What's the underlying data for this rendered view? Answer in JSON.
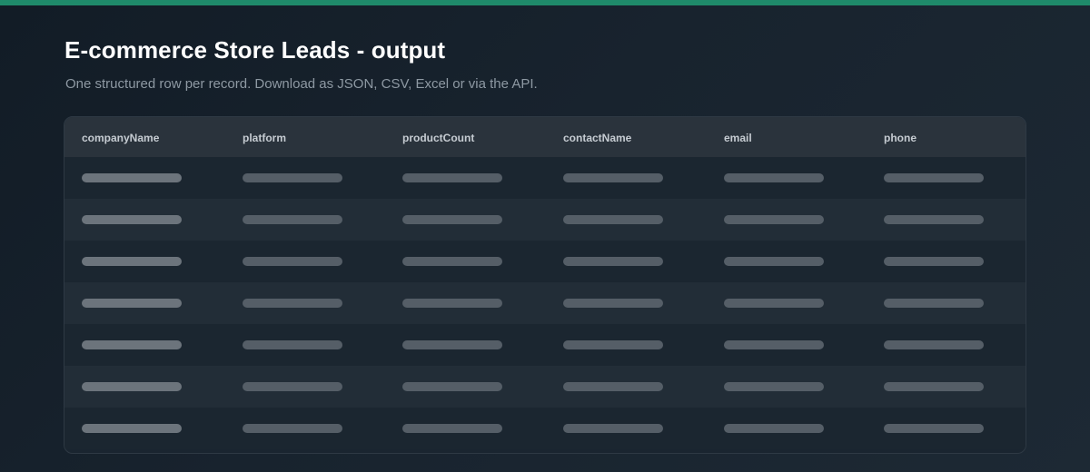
{
  "header": {
    "title": "E-commerce Store Leads - output",
    "subtitle": "One structured row per record. Download as JSON, CSV, Excel or via the API."
  },
  "table": {
    "columns": [
      "companyName",
      "platform",
      "productCount",
      "contactName",
      "email",
      "phone"
    ],
    "row_count": 7,
    "rows_loading": true
  },
  "colors": {
    "accent": "#1f8a6a",
    "background": "#16202a",
    "header_row": "#2a333c",
    "skeleton": "#555e67"
  }
}
